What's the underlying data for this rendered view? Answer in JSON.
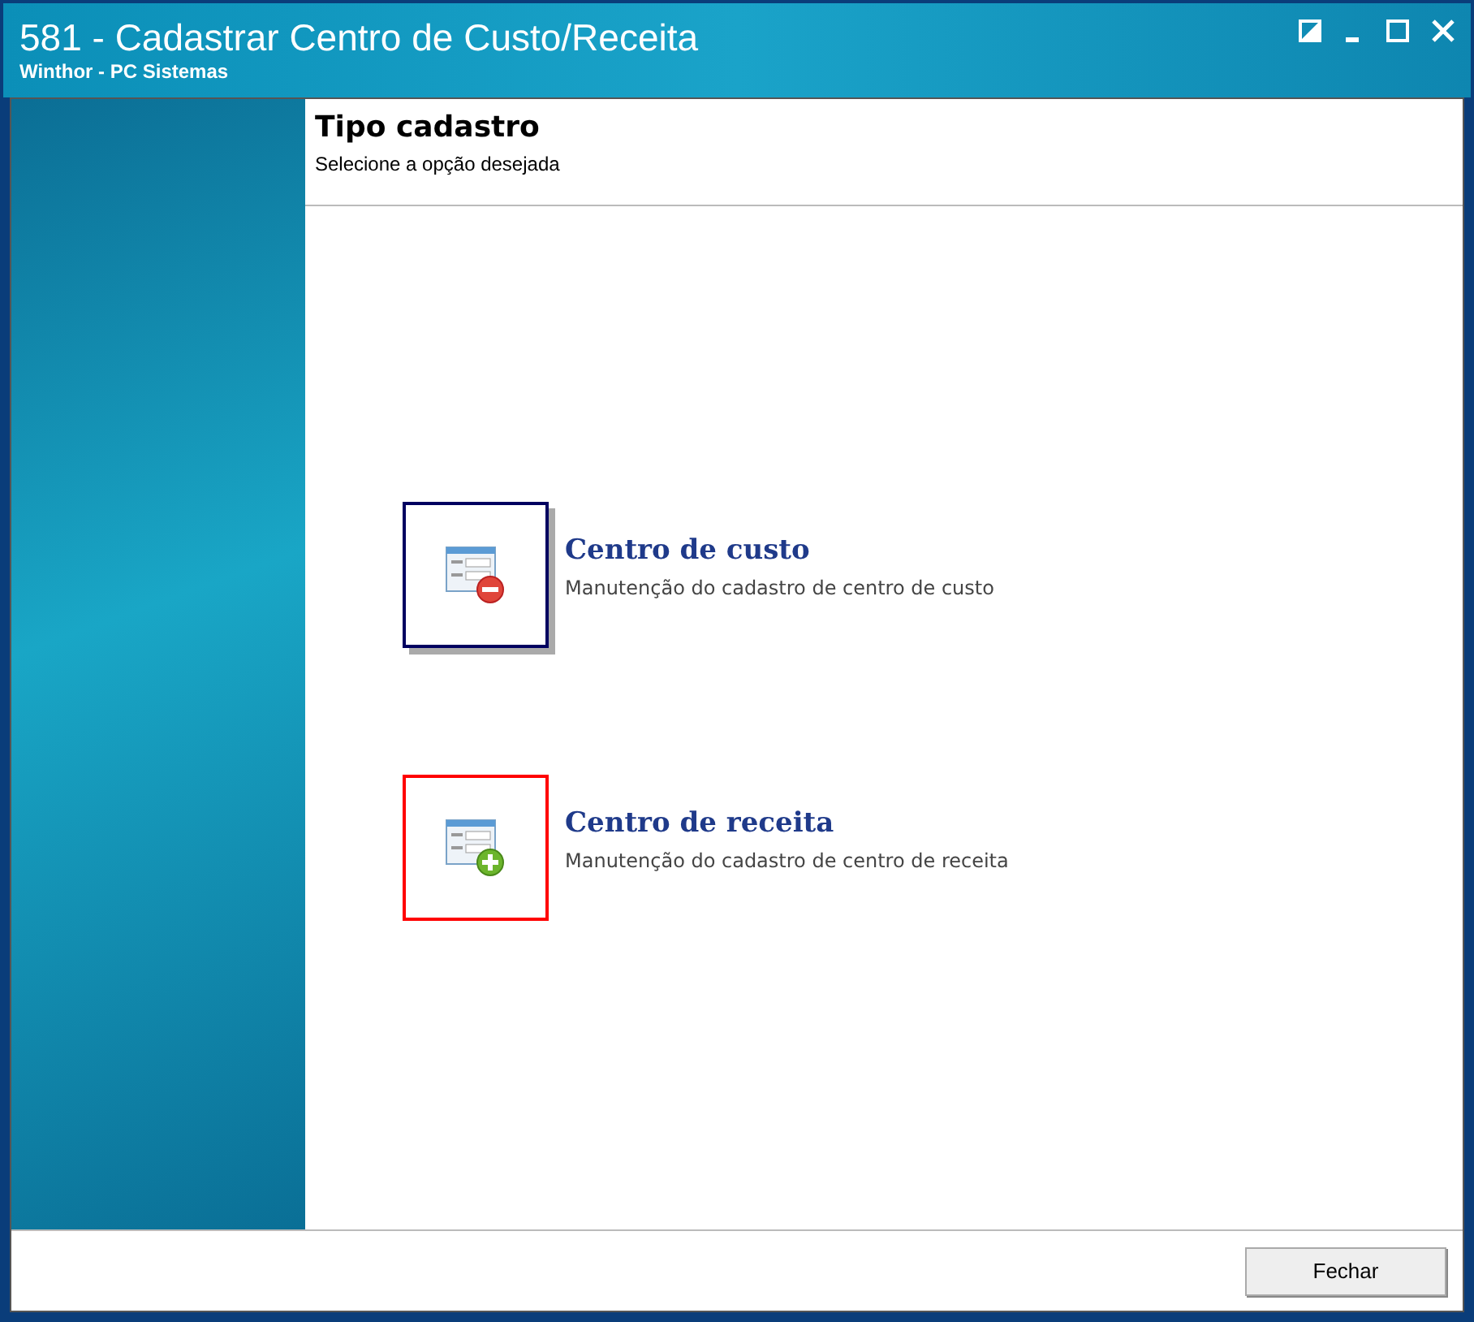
{
  "window": {
    "title": "581 - Cadastrar Centro de Custo/Receita",
    "subtitle": "Winthor - PC Sistemas"
  },
  "header": {
    "title": "Tipo cadastro",
    "subtitle": "Selecione a opção desejada"
  },
  "options": [
    {
      "kind": "remove",
      "title": "Centro de custo",
      "description": "Manutenção do cadastro de centro de custo",
      "selected": true,
      "highlighted": false
    },
    {
      "kind": "add",
      "title": "Centro de receita",
      "description": "Manutenção do cadastro de centro de receita",
      "selected": false,
      "highlighted": true
    }
  ],
  "buttons": [
    "Fechar"
  ]
}
